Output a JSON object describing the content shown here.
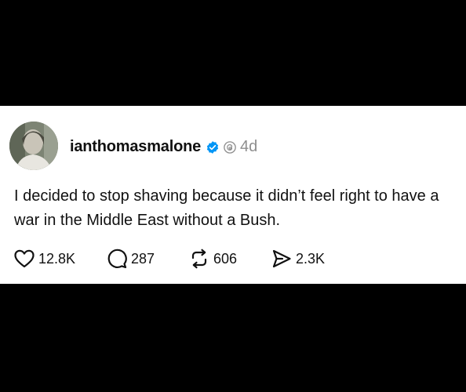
{
  "post": {
    "username": "ianthomasmalone",
    "time": "4d",
    "text": "I decided to stop shaving because it didn’t feel right to have a war in the Middle East without a Bush.",
    "actions": {
      "likes": "12.8K",
      "replies": "287",
      "reposts": "606",
      "shares": "2.3K"
    },
    "icons": {
      "verified": "verified-badge-icon",
      "threads": "threads-logo-icon",
      "like": "heart-icon",
      "reply": "comment-bubble-icon",
      "repost": "repost-arrows-icon",
      "share": "share-send-icon"
    },
    "colors": {
      "page_background": "#000000",
      "card_background": "#ffffff",
      "verified_badge": "#0095f6",
      "muted_text": "#8e8e8e",
      "text": "#111111"
    }
  }
}
